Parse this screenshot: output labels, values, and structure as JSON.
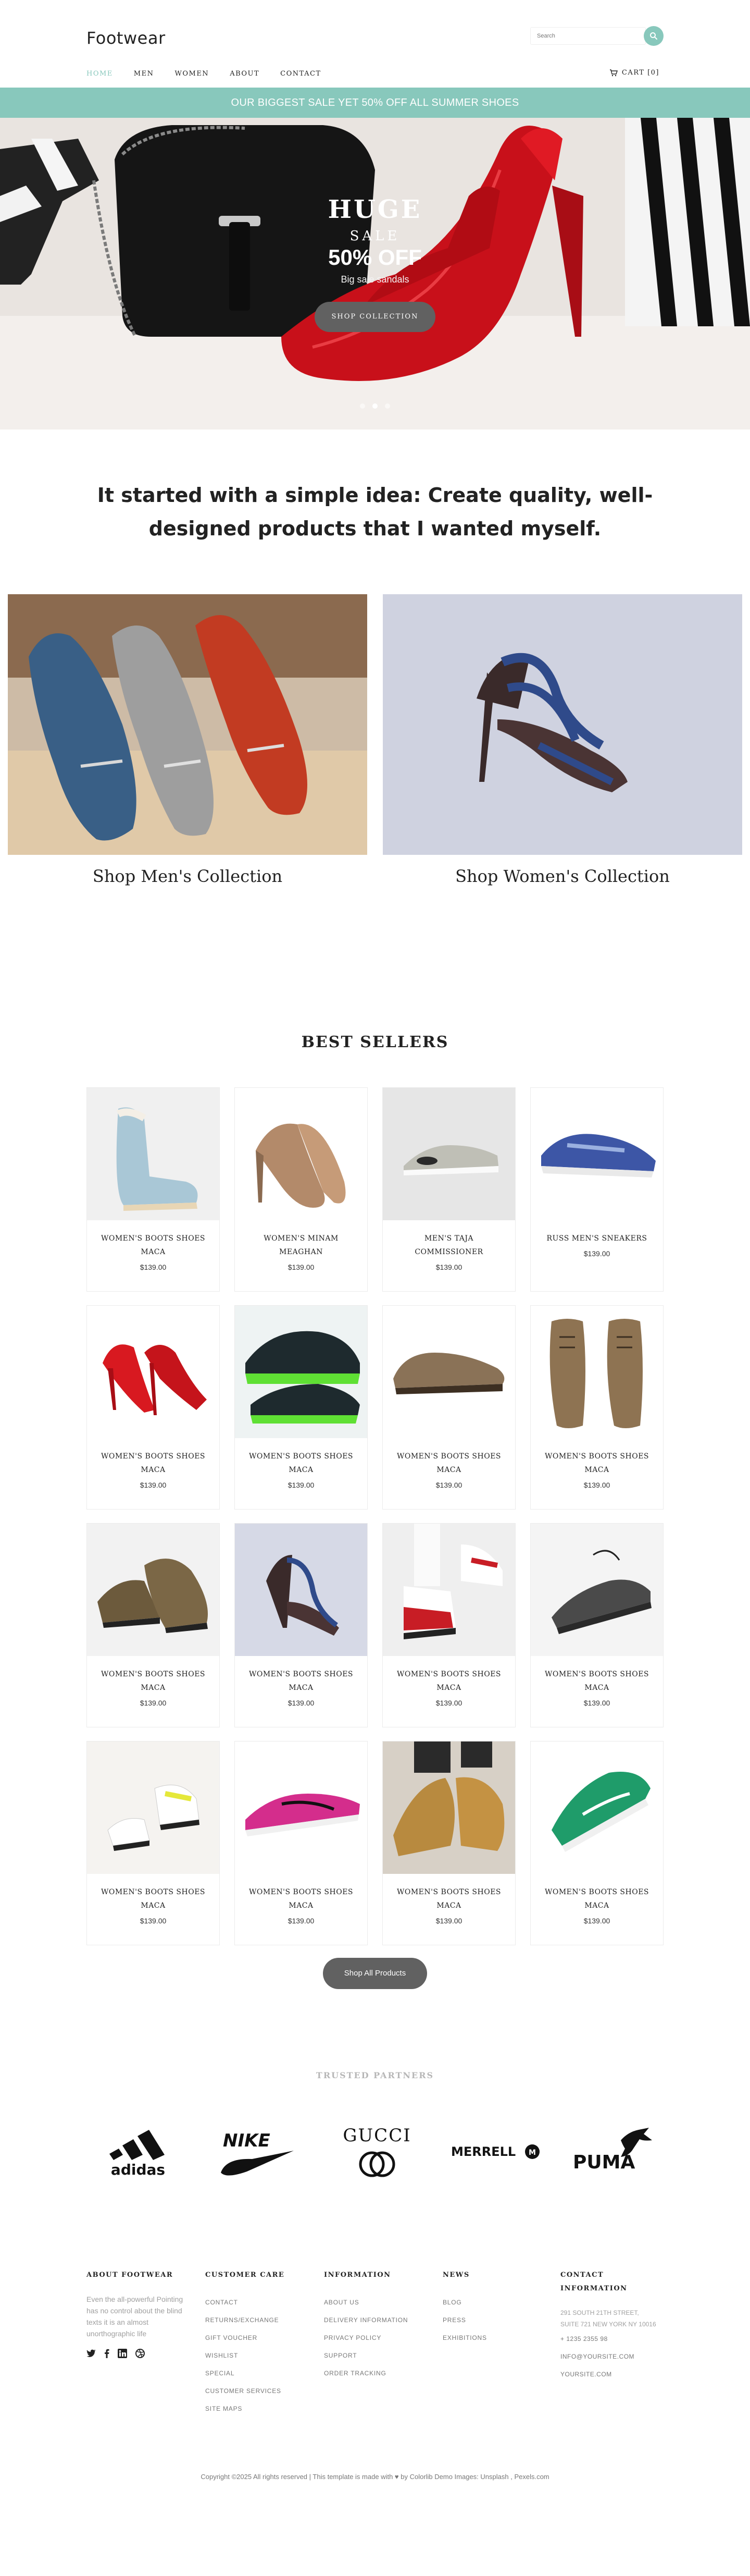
{
  "header": {
    "logo": "Footwear",
    "search_placeholder": "Search",
    "nav": [
      {
        "label": "Home",
        "active": true
      },
      {
        "label": "Men",
        "active": false
      },
      {
        "label": "Women",
        "active": false
      },
      {
        "label": "About",
        "active": false
      },
      {
        "label": "Contact",
        "active": false
      }
    ],
    "cart_label": "Cart [0]"
  },
  "promo_bar": "Our biggest sale yet 50% off all summer shoes",
  "hero": {
    "line1": "HUGE",
    "line2": "SALE",
    "line3": "50% OFF",
    "line4": "Big sale sandals",
    "button": "Shop Collection",
    "slides": 3,
    "active_slide": 2
  },
  "intro": "It started with a simple idea: Create quality, well-designed products that I wanted myself.",
  "collections": [
    {
      "title": "Shop Men's Collection"
    },
    {
      "title": "Shop Women's Collection"
    }
  ],
  "best_sellers": {
    "title": "Best Sellers",
    "products": [
      {
        "name": "Women's Boots Shoes Maca",
        "price": "$139.00",
        "icon": "boot-icon"
      },
      {
        "name": "Women's Minam Meaghan",
        "price": "$139.00",
        "icon": "pump-icon"
      },
      {
        "name": "Men's Taja Commissioner",
        "price": "$139.00",
        "icon": "sneaker-icon"
      },
      {
        "name": "Russ Men's Sneakers",
        "price": "$139.00",
        "icon": "sneaker-icon"
      },
      {
        "name": "Women's Boots Shoes Maca",
        "price": "$139.00",
        "icon": "pump-icon"
      },
      {
        "name": "Women's Boots Shoes Maca",
        "price": "$139.00",
        "icon": "sneaker-icon"
      },
      {
        "name": "Women's Boots Shoes Maca",
        "price": "$139.00",
        "icon": "loafer-icon"
      },
      {
        "name": "Women's Boots Shoes Maca",
        "price": "$139.00",
        "icon": "boot-icon"
      },
      {
        "name": "Women's Boots Shoes Maca",
        "price": "$139.00",
        "icon": "boot-icon"
      },
      {
        "name": "Women's Boots Shoes Maca",
        "price": "$139.00",
        "icon": "heel-icon"
      },
      {
        "name": "Women's Boots Shoes Maca",
        "price": "$139.00",
        "icon": "sneaker-icon"
      },
      {
        "name": "Women's Boots Shoes Maca",
        "price": "$139.00",
        "icon": "sneaker-icon"
      },
      {
        "name": "Women's Boots Shoes Maca",
        "price": "$139.00",
        "icon": "sneaker-icon"
      },
      {
        "name": "Women's Boots Shoes Maca",
        "price": "$139.00",
        "icon": "sneaker-icon"
      },
      {
        "name": "Women's Boots Shoes Maca",
        "price": "$139.00",
        "icon": "sneaker-icon"
      },
      {
        "name": "Women's Boots Shoes Maca",
        "price": "$139.00",
        "icon": "sneaker-icon"
      }
    ],
    "shop_all": "Shop All Products"
  },
  "partners": {
    "title": "Trusted Partners",
    "logos": [
      "adidas",
      "NIKE",
      "GUCCI",
      "MERRELL",
      "PUMA"
    ]
  },
  "footer": {
    "about": {
      "title": "About Footwear",
      "text": "Even the all-powerful Pointing has no control about the blind texts it is an almost unorthographic life"
    },
    "customer_care": {
      "title": "Customer Care",
      "links": [
        "Contact",
        "Returns/Exchange",
        "Gift Voucher",
        "Wishlist",
        "Special",
        "Customer Services",
        "Site maps"
      ]
    },
    "information": {
      "title": "Information",
      "links": [
        "About us",
        "Delivery Information",
        "Privacy Policy",
        "Support",
        "Order Tracking"
      ]
    },
    "news": {
      "title": "News",
      "links": [
        "Blog",
        "Press",
        "Exhibitions"
      ]
    },
    "contact": {
      "title": "Contact Information",
      "address_line1": "291 South 21th Street,",
      "address_line2": "Suite 721 New York NY 10016",
      "phone": "+ 1235 2355 98",
      "email": "info@yoursite.com",
      "website": "yoursite.com"
    },
    "copyright": "Copyright ©2025 All rights reserved | This template is made with ♥ by Colorlib Demo Images: Unsplash , Pexels.com"
  },
  "colors": {
    "accent": "#88c8bc",
    "button": "#616161",
    "text": "#222222"
  }
}
